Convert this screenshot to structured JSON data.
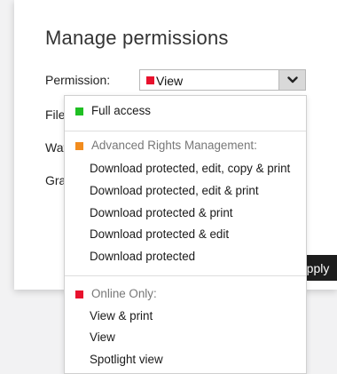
{
  "dialog": {
    "title": "Manage permissions",
    "permission_label": "Permission:",
    "file_expiry_label": "File ex",
    "watermark_label": "Water",
    "grant_label": "Grant",
    "apply_label": "pply"
  },
  "permission_select": {
    "selected": "View",
    "selected_color": "#e8112d"
  },
  "dropdown": {
    "full_access": {
      "label": "Full access",
      "color": "#1fbf23"
    },
    "arm_group": {
      "label": "Advanced Rights Management:",
      "color": "#f28c1e",
      "items": [
        "Download protected, edit, copy & print",
        "Download protected, edit & print",
        "Download protected & print",
        "Download protected & edit",
        "Download protected"
      ]
    },
    "online_group": {
      "label": "Online Only:",
      "color": "#e8112d",
      "items": [
        "View & print",
        "View",
        "Spotlight view"
      ]
    }
  }
}
